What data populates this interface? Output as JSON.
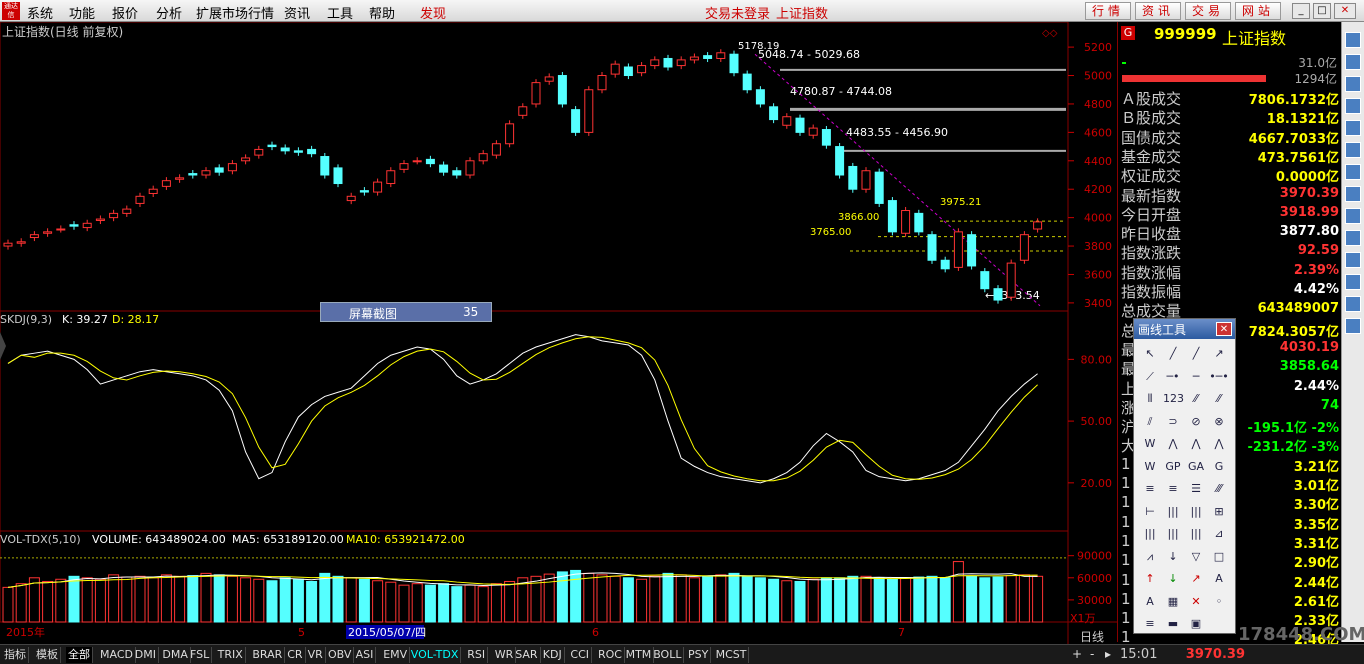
{
  "menu": {
    "system": "系统",
    "func": "功能",
    "report": "报价",
    "analysis": "分析",
    "ext": "扩展市场行情",
    "info": "资讯",
    "tools": "工具",
    "help": "帮助",
    "discover": "发现"
  },
  "status": {
    "trade": "交易未登录",
    "index": "上证指数"
  },
  "nav": {
    "quote": "行情",
    "info": "资讯",
    "trade": "交易",
    "web": "网站"
  },
  "chart": {
    "title": "上证指数(日线 前复权)",
    "kdj_label": "SKDJ(9,3)",
    "k": "K: 39.27",
    "d": "D: 28.17",
    "vol_label": "VOL-TDX(5,10)",
    "volume": "VOLUME: 643489024.00",
    "ma5": "MA5: 653189120.00",
    "ma10": "MA10: 653921472.00",
    "price_ticks": [
      "5200",
      "5000",
      "4800",
      "4600",
      "4400",
      "4200",
      "4000",
      "3800",
      "3600",
      "3400"
    ],
    "kdj_ticks": [
      "80.00",
      "50.00",
      "20.00"
    ],
    "vol_ticks": [
      "90000",
      "60000",
      "30000"
    ],
    "vol_unit": "X1万",
    "annotations": {
      "high": "5178.19",
      "h1": "5048.74 - 5029.68",
      "h2": "4780.87 - 4744.08",
      "h3": "4483.55 - 4456.90",
      "a1": "3975.21",
      "a2": "3866.00",
      "a3": "3765.00",
      "low": "3373.54"
    },
    "date_axis": {
      "start": "2015年",
      "m5": "5",
      "cursor": "2015/05/07/四",
      "m6": "6",
      "m7": "7"
    },
    "period": "日线"
  },
  "chart_data": {
    "type": "candlestick",
    "title": "上证指数(日线 前复权)",
    "ylim": [
      3350,
      5250
    ],
    "yticks": [
      5200,
      5000,
      4800,
      4600,
      4400,
      4200,
      4000,
      3800,
      3600,
      3400
    ],
    "annotated_levels": [
      5178.19,
      5048.74,
      5029.68,
      4780.87,
      4744.08,
      4483.55,
      4456.9,
      3975.21,
      3866.0,
      3765.0,
      3373.54
    ],
    "kdj": {
      "K": 39.27,
      "D": 28.17,
      "ticks": [
        80,
        50,
        20
      ]
    },
    "volume": {
      "last": 643489024,
      "MA5": 653189120,
      "MA10": 653921472,
      "unit": "X1万",
      "ticks": [
        90000,
        60000,
        30000
      ]
    }
  },
  "screencap": {
    "label": "屏幕截图",
    "value": "35"
  },
  "quote": {
    "code": "999999",
    "name": "上证指数",
    "g": "G",
    "r1": "31.0亿",
    "r2": "1294亿",
    "rows": [
      {
        "l": "Ａ股成交",
        "v": "7806.1732亿",
        "c": "#ff0"
      },
      {
        "l": "Ｂ股成交",
        "v": "18.1321亿",
        "c": "#ff0"
      },
      {
        "l": "国债成交",
        "v": "4667.7033亿",
        "c": "#ff0"
      },
      {
        "l": "基金成交",
        "v": "473.7561亿",
        "c": "#ff0"
      },
      {
        "l": "权证成交",
        "v": "0.0000亿",
        "c": "#ff0"
      },
      {
        "l": "最新指数",
        "v": "3970.39",
        "c": "#f33"
      },
      {
        "l": "今日开盘",
        "v": "3918.99",
        "c": "#f33"
      },
      {
        "l": "昨日收盘",
        "v": "3877.80",
        "c": "#fff"
      },
      {
        "l": "指数涨跌",
        "v": "92.59",
        "c": "#f33"
      },
      {
        "l": "指数涨幅",
        "v": "2.39%",
        "c": "#f33"
      },
      {
        "l": "指数振幅",
        "v": "4.42%",
        "c": "#fff"
      },
      {
        "l": "总成交量",
        "v": "643489007",
        "c": "#ff0"
      },
      {
        "l": "总",
        "v": "7824.3057亿",
        "c": "#ff0"
      },
      {
        "l": "最",
        "v": "4030.19",
        "c": "#f33"
      },
      {
        "l": "最",
        "v": "3858.64",
        "c": "#0f0"
      },
      {
        "l": "上",
        "v": "2.44%",
        "c": "#fff"
      },
      {
        "l": "涨 跌家数",
        "v": "74",
        "c": "#0f0"
      },
      {
        "l": "沪",
        "v": "-195.1亿  -2%",
        "c": "#0f0"
      },
      {
        "l": "大",
        "v": "-231.2亿  -3%",
        "c": "#0f0"
      },
      {
        "l": "1",
        "v": "3.21亿",
        "c": "#ff0"
      },
      {
        "l": "1",
        "v": "3.01亿",
        "c": "#ff0"
      },
      {
        "l": "1",
        "v": "3.30亿",
        "c": "#ff0"
      },
      {
        "l": "1",
        "v": "3.35亿",
        "c": "#ff0"
      },
      {
        "l": "1",
        "v": "3.31亿",
        "c": "#ff0"
      },
      {
        "l": "1",
        "v": "2.90亿",
        "c": "#ff0"
      },
      {
        "l": "1",
        "v": "2.44亿",
        "c": "#ff0"
      },
      {
        "l": "1",
        "v": "2.61亿",
        "c": "#ff0"
      },
      {
        "l": "1",
        "v": "2.33亿",
        "c": "#ff0"
      },
      {
        "l": "1",
        "v": "2.46亿",
        "c": "#ff0"
      }
    ]
  },
  "drawtool": {
    "title": "画线工具"
  },
  "tabs": [
    "指标",
    "模板",
    "全部",
    "MACD",
    "DMI",
    "DMA",
    "FSL",
    "TRIX",
    "BRAR",
    "CR",
    "VR",
    "OBV",
    "ASI",
    "EMV",
    "VOL-TDX",
    "RSI",
    "WR",
    "SAR",
    "KDJ",
    "CCI",
    "ROC",
    "MTM",
    "BOLL",
    "PSY",
    "MCST"
  ],
  "clock": "15:01",
  "lastprice": "3970.39",
  "watermark": "178448.COM"
}
